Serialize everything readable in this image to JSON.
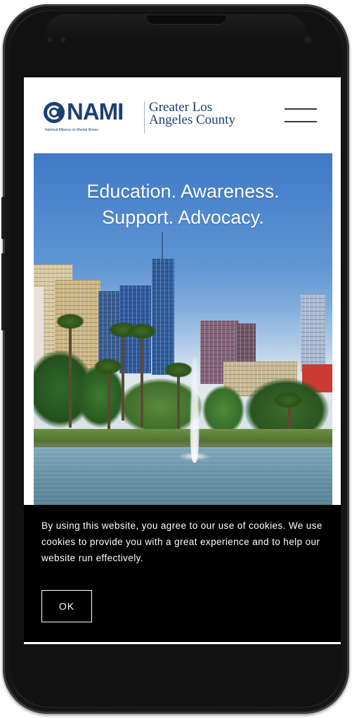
{
  "header": {
    "logo_wordmark": "NAMI",
    "logo_tagline": "National Alliance on Mental Illness",
    "org_name_line1": "Greater Los",
    "org_name_line2": "Angeles County",
    "menu_icon": "hamburger-menu-icon"
  },
  "hero": {
    "title_line1": "Education. Awareness.",
    "title_line2": "Support. Advocacy."
  },
  "cookie_banner": {
    "message": "By using this website, you agree to our use of cookies. We use cookies to provide you with a great experience and to help our website run effectively.",
    "ok_label": "OK"
  },
  "colors": {
    "brand_navy": "#1d3f73",
    "banner_bg": "#000000",
    "text_white": "#ffffff"
  }
}
